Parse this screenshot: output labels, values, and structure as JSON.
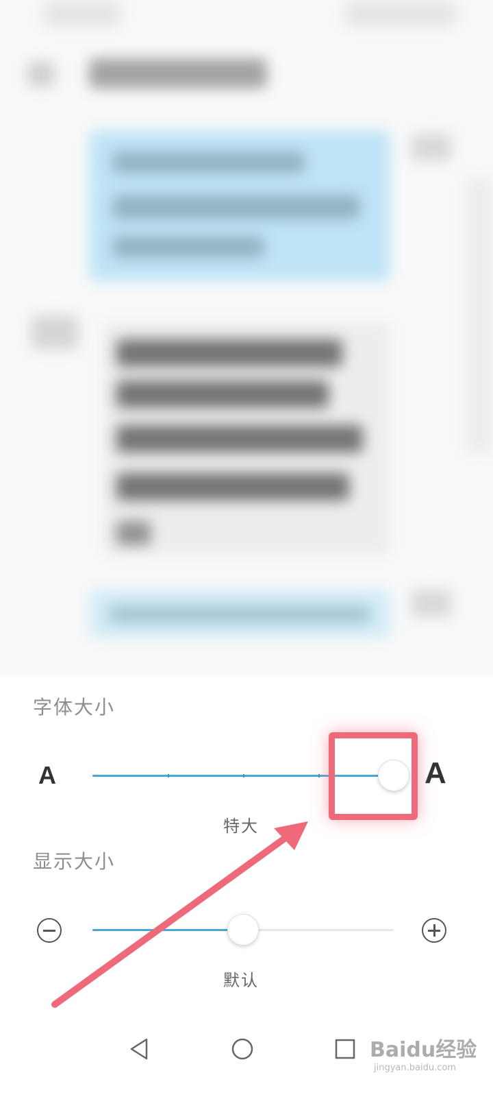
{
  "font_size": {
    "title": "字体大小",
    "small_a": "A",
    "large_a": "A",
    "value_label": "特大",
    "levels": 5,
    "selected_level": 5
  },
  "display_size": {
    "title": "显示大小",
    "value_label": "默认",
    "levels": 3,
    "selected_level": 2
  },
  "navbar": {
    "back": "back-icon",
    "home": "home-icon",
    "recent": "recent-apps-icon"
  },
  "watermark": {
    "text": "Baidu经验",
    "sub": "jingyan.baidu.com"
  },
  "colors": {
    "accent": "#4aa8d8",
    "annotation": "#ee6a7a"
  }
}
